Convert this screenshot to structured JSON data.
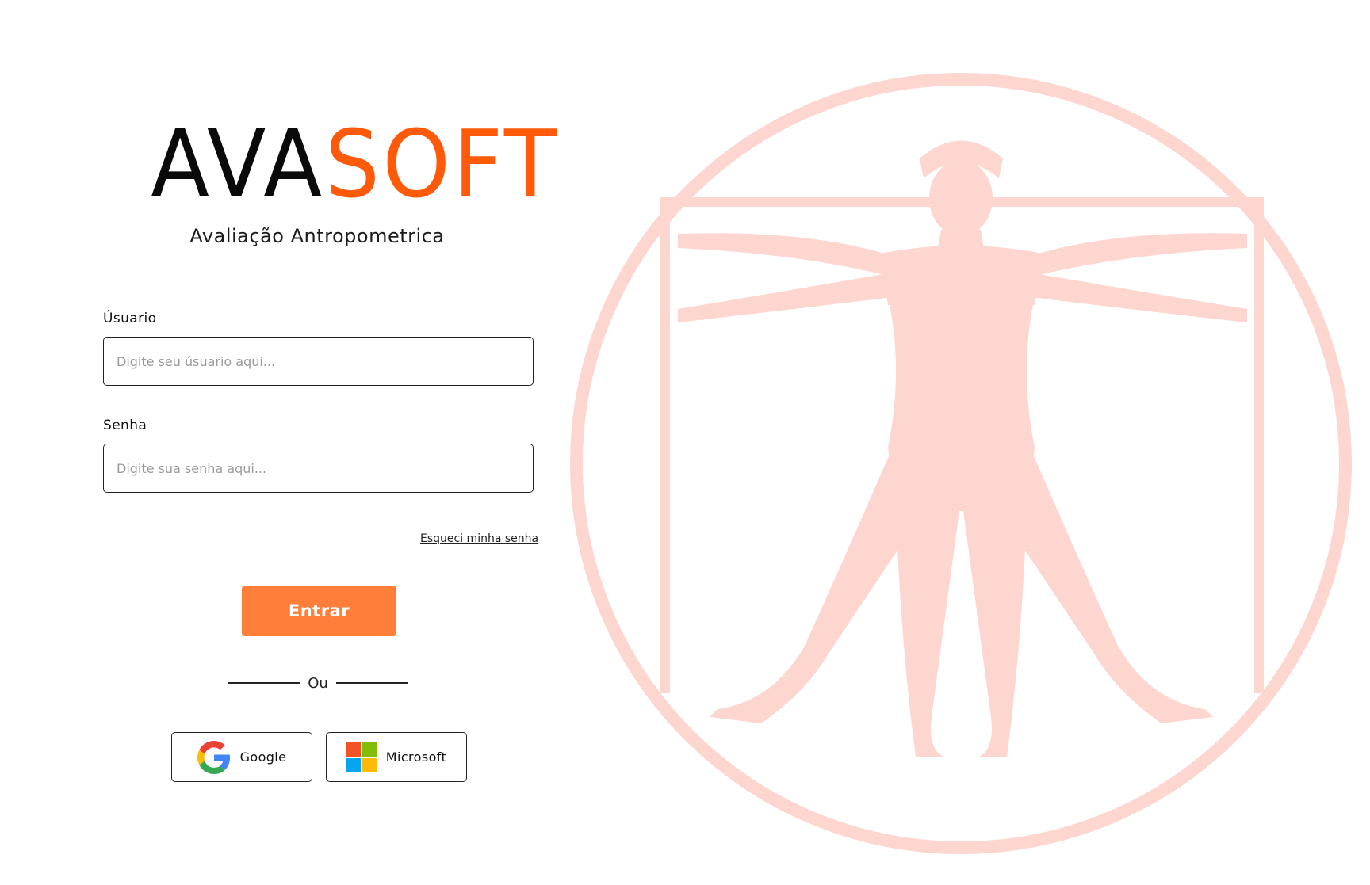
{
  "brand": {
    "logo_part1": "AVA",
    "logo_part2": "SOFT",
    "subtitle": "Avaliação Antropometrica",
    "logo_color_dark": "#0a0a0a",
    "logo_color_accent": "#ff5a0a"
  },
  "form": {
    "user_label": "Úsuario",
    "user_placeholder": "Digite seu úsuario aqui...",
    "password_label": "Senha",
    "password_placeholder": "Digite sua senha aqui...",
    "forgot_link": "Esqueci minha senha",
    "submit_label": "Entrar",
    "submit_color": "#ff7f3a"
  },
  "divider": {
    "text": "Ou"
  },
  "social": {
    "google_label": "Google",
    "google_icon": "google-g-icon",
    "microsoft_label": "Microsoft",
    "microsoft_icon": "microsoft-windows-icon"
  },
  "illustration": {
    "name": "vitruvian-figure-illustration",
    "color": "#fdd6cf"
  }
}
